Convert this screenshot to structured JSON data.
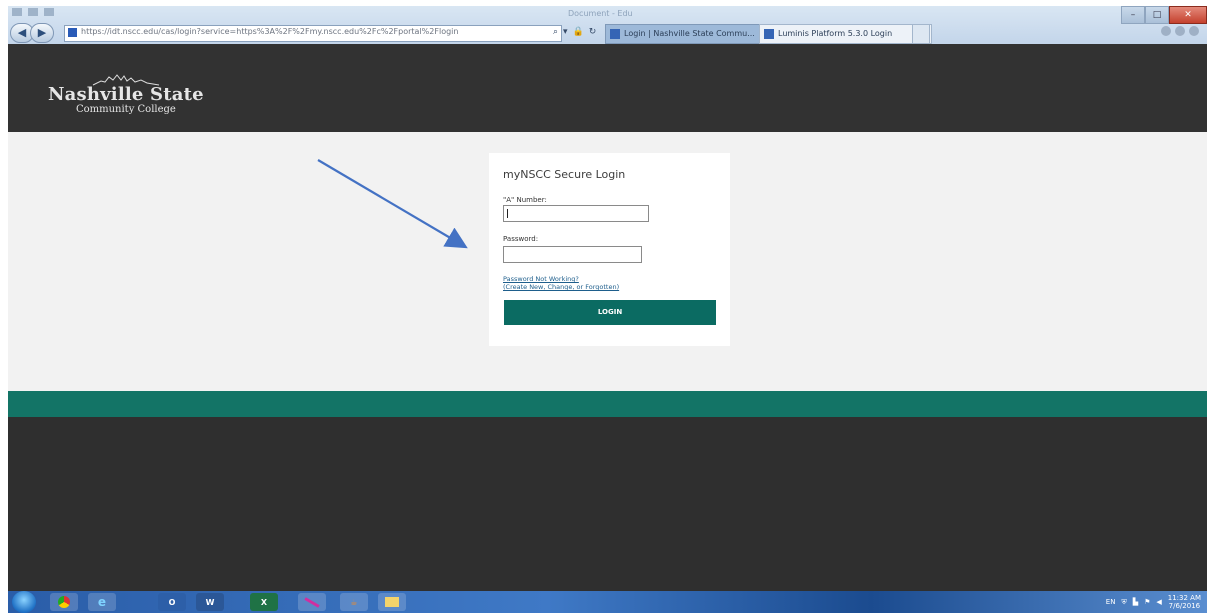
{
  "browser": {
    "window_title": "Document - Edu",
    "address_url": "https://idt.nscc.edu/cas/login?service=https%3A%2F%2Fmy.nscc.edu%2Fc%2Fportal%2Flogin",
    "tabs": [
      {
        "label": "Login | Nashville State Commu..."
      },
      {
        "label": "Luminis Platform 5.3.0 Login"
      }
    ],
    "tab_close": "×",
    "back_glyph": "◀",
    "forward_glyph": "▶",
    "addr_tools": [
      "⌕",
      "▾",
      "🔒",
      "↻"
    ],
    "win_min": "–",
    "win_max": "□",
    "win_close": "✕"
  },
  "site": {
    "logo_line1": "Nashville State",
    "logo_line2": "Community College"
  },
  "login": {
    "title": "myNSCC Secure Login",
    "a_number_label": "\"A\" Number:",
    "a_number_value": "",
    "password_label": "Password:",
    "password_value": "",
    "link_password": "Password Not Working?",
    "link_create": "(Create New, Change, or Forgotten)",
    "login_button": "LOGIN"
  },
  "taskbar": {
    "items": [
      "Chrome",
      "IE",
      "O",
      "W",
      "X",
      "Pen",
      "Java",
      "Folder"
    ],
    "tray_time": "11:32 AM",
    "tray_date": "7/6/2016"
  },
  "colors": {
    "teal": "#0b6b62",
    "header": "#323232",
    "arrow": "#4472c4"
  }
}
